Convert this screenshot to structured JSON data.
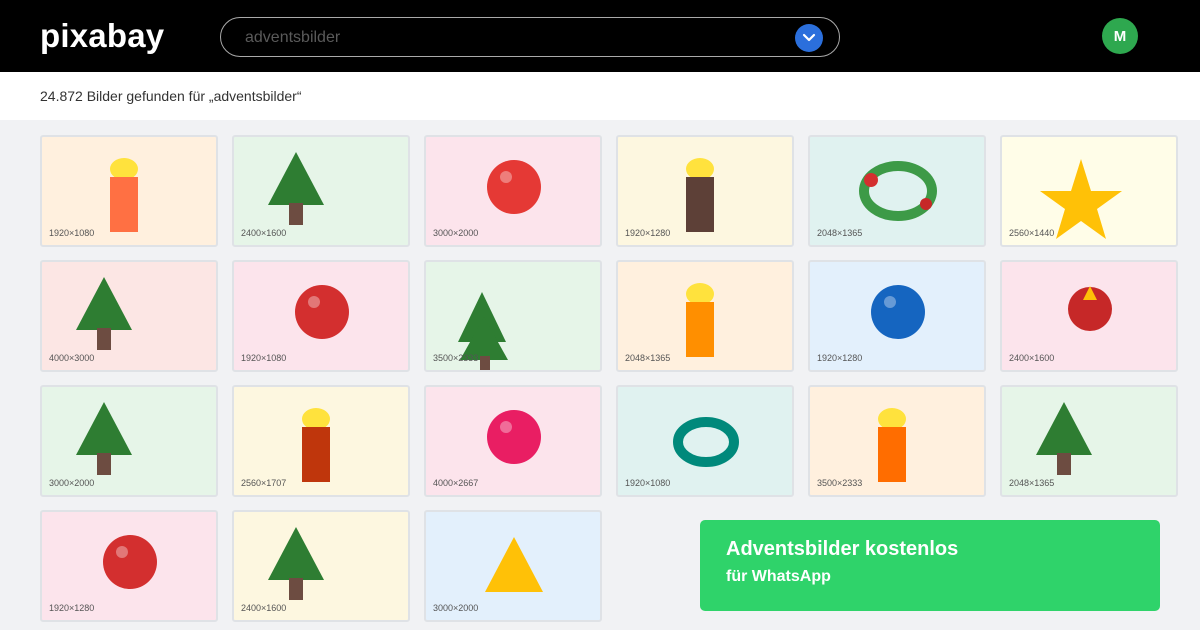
{
  "brand": {
    "logo_text": "pixabay"
  },
  "search": {
    "query": "adventsbilder",
    "button_icon": "chevron-down-icon",
    "button_color": "#2b6fdc"
  },
  "user": {
    "avatar_letter": "M",
    "avatar_color": "#2ea84f"
  },
  "results": {
    "summary": "24.872 Bilder gefunden für „adventsbilder“"
  },
  "grid": {
    "tiles": [
      {
        "dim": "1920×1080",
        "bg": "#fff0de",
        "motif": "candle"
      },
      {
        "dim": "2400×1600",
        "bg": "#e6f5e8",
        "motif": "tree"
      },
      {
        "dim": "3000×2000",
        "bg": "#fce4ec",
        "motif": "ornament"
      },
      {
        "dim": "1920×1280",
        "bg": "#fdf7e0",
        "motif": "candle"
      },
      {
        "dim": "2048×1365",
        "bg": "#e0f2f0",
        "motif": "wreath"
      },
      {
        "dim": "2560×1440",
        "bg": "#fffde8",
        "motif": "star"
      },
      {
        "dim": "4000×3000",
        "bg": "#fce6e4",
        "motif": "tree"
      },
      {
        "dim": "1920×1080",
        "bg": "#fce4ec",
        "motif": "ornament"
      },
      {
        "dim": "3500×2333",
        "bg": "#e6f5e8",
        "motif": "trees"
      },
      {
        "dim": "2048×1365",
        "bg": "#fff0de",
        "motif": "candle"
      },
      {
        "dim": "1920×1280",
        "bg": "#e3f0fc",
        "motif": "ornament"
      },
      {
        "dim": "2400×1600",
        "bg": "#fce4ec",
        "motif": "ornament-star"
      },
      {
        "dim": "3000×2000",
        "bg": "#e6f5e8",
        "motif": "tree"
      },
      {
        "dim": "2560×1707",
        "bg": "#fdf7e0",
        "motif": "candle"
      },
      {
        "dim": "4000×2667",
        "bg": "#fce4ec",
        "motif": "ornament"
      },
      {
        "dim": "1920×1080",
        "bg": "#e0f2f0",
        "motif": "ring"
      },
      {
        "dim": "3500×2333",
        "bg": "#fff0de",
        "motif": "candle"
      },
      {
        "dim": "2048×1365",
        "bg": "#e6f5e8",
        "motif": "tree"
      },
      {
        "dim": "1920×1280",
        "bg": "#fce4ec",
        "motif": "ornament"
      },
      {
        "dim": "2400×1600",
        "bg": "#fdf7e0",
        "motif": "tree"
      },
      {
        "dim": "3000×2000",
        "bg": "#e3f0fc",
        "motif": "triangle"
      }
    ]
  },
  "cta": {
    "title": "Adventsbilder kostenlos",
    "subtitle": "für WhatsApp",
    "color": "#2fd36a"
  }
}
